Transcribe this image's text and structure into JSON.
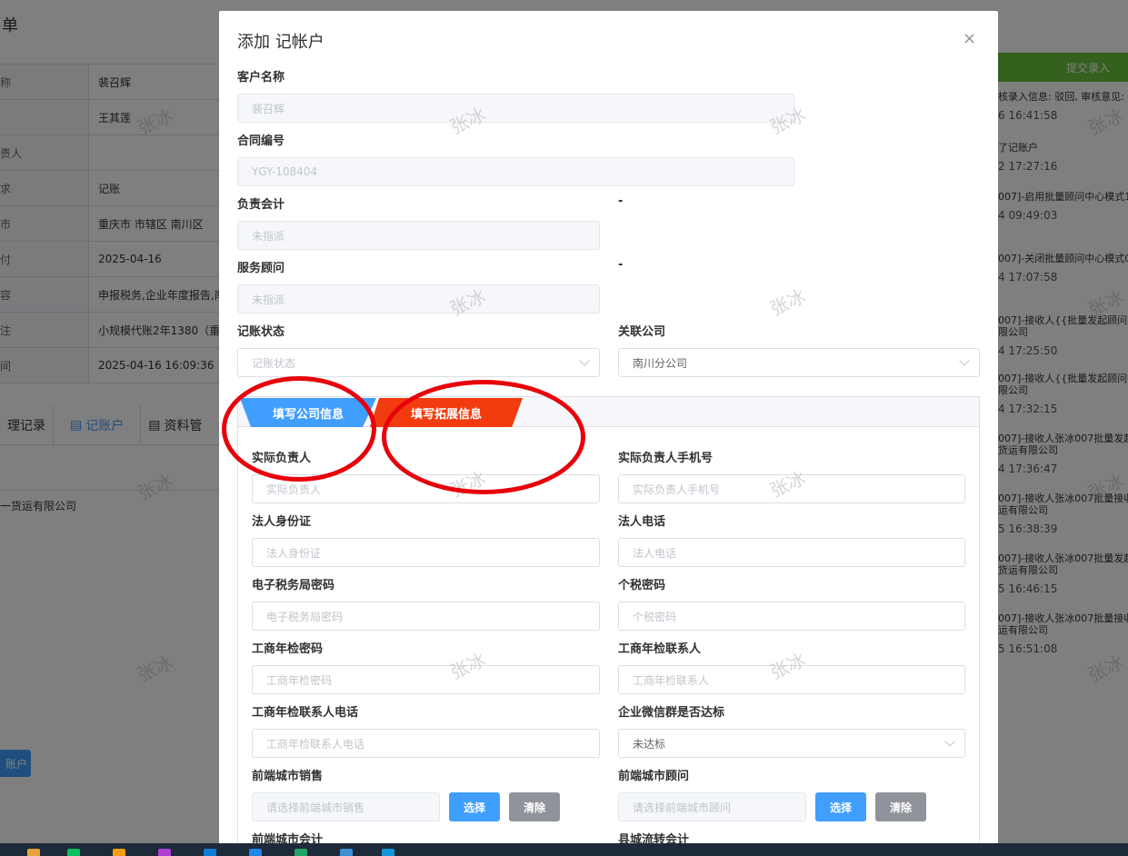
{
  "background": {
    "title": "单",
    "table": [
      {
        "key": "称",
        "value": "裴召辉"
      },
      {
        "key": "",
        "value": "王其莲"
      },
      {
        "key": "责人",
        "value": ""
      },
      {
        "key": "求",
        "value": "记账"
      },
      {
        "key": "市",
        "value": "重庆市 市辖区 南川区"
      },
      {
        "key": "付",
        "value": "2025-04-16"
      },
      {
        "key": "容",
        "value": "申报税务,企业年度报告,南"
      },
      {
        "key": "注",
        "value": "小规模代账2年1380（重庆"
      },
      {
        "key": "间",
        "value": "2025-04-16 16:09:36"
      }
    ],
    "tabs": [
      "理记录",
      "记账户",
      "资料管"
    ],
    "list_item": "一货运有限公司",
    "bottom_button": "账户",
    "right_panel_button": "提交录入",
    "logs": [
      {
        "text": "核录入信息: 驳回, 审核意见: 无",
        "time": "6 16:41:58"
      },
      {
        "text": "了记账户",
        "time": "2 17:27:16"
      },
      {
        "text": "007]-启用批量顾问中心模式1,",
        "time": "4 09:49:03"
      },
      {
        "text": "007]-关闭批量顾问中心模式0,",
        "time": "4 17:07:58"
      },
      {
        "text": "007]-接收人{{批量发起顾问中心",
        "text2": "限公司",
        "time": "4 17:25:50"
      },
      {
        "text": "007]-接收人{{批量发起顾问中心",
        "text2": "限公司",
        "time": "4 17:32:15"
      },
      {
        "text": "007]-接收人张冰007批量发起顾",
        "text2": "货运有限公司",
        "time": "4 17:36:47"
      },
      {
        "text": "007]-接收人张冰007批量接收顾",
        "text2": "运有限公司",
        "time": "5 16:38:39"
      },
      {
        "text": "007]-接收人张冰007批量发起顾",
        "text2": "货运有限公司",
        "time": "5 16:46:15"
      },
      {
        "text": "007]-接收人张冰007批量接收顾",
        "text2": "运有限公司",
        "time": "5 16:51:08"
      }
    ],
    "watermark": "张冰"
  },
  "dialog": {
    "title": "添加 记帐户",
    "close": "×",
    "customer_name": {
      "label": "客户名称",
      "value": "裴召辉"
    },
    "contract_no": {
      "label": "合同编号",
      "value": "YGY-108404"
    },
    "accountant": {
      "label": "负责会计",
      "value": "未指派",
      "dash": "-"
    },
    "advisor": {
      "label": "服务顾问",
      "value": "未指派",
      "dash": "-"
    },
    "status": {
      "label": "记账状态",
      "placeholder": "记账状态"
    },
    "company": {
      "label": "关联公司",
      "value": "南川分公司"
    },
    "tabs": {
      "company_info": "填写公司信息",
      "extended_info": "填写拓展信息"
    },
    "fields": {
      "actual_person": {
        "label": "实际负责人",
        "placeholder": "实际负责人"
      },
      "actual_phone": {
        "label": "实际负责人手机号",
        "placeholder": "实际负责人手机号"
      },
      "legal_id": {
        "label": "法人身份证",
        "placeholder": "法人身份证"
      },
      "legal_phone": {
        "label": "法人电话",
        "placeholder": "法人电话"
      },
      "etax_pwd": {
        "label": "电子税务局密码",
        "placeholder": "电子税务局密码"
      },
      "itax_pwd": {
        "label": "个税密码",
        "placeholder": "个税密码"
      },
      "annual_pwd": {
        "label": "工商年检密码",
        "placeholder": "工商年检密码"
      },
      "annual_contact": {
        "label": "工商年检联系人",
        "placeholder": "工商年检联系人"
      },
      "annual_contact_phone": {
        "label": "工商年检联系人电话",
        "placeholder": "工商年检联系人电话"
      },
      "wechat_group": {
        "label": "企业微信群是否达标",
        "value": "未达标"
      },
      "city_sales": {
        "label": "前端城市销售",
        "placeholder": "请选择前端城市销售"
      },
      "city_advisor": {
        "label": "前端城市顾问",
        "placeholder": "请选择前端城市顾问"
      },
      "city_accountant": {
        "label": "前端城市会计"
      },
      "county_accountant": {
        "label": "县城流转会计"
      }
    },
    "buttons": {
      "select": "选择",
      "clear": "清除"
    }
  },
  "colors": {
    "primary": "#409eff",
    "danger_tab": "#f23c0f",
    "annotation": "#e8000b",
    "submit_green": "#67c23a"
  }
}
